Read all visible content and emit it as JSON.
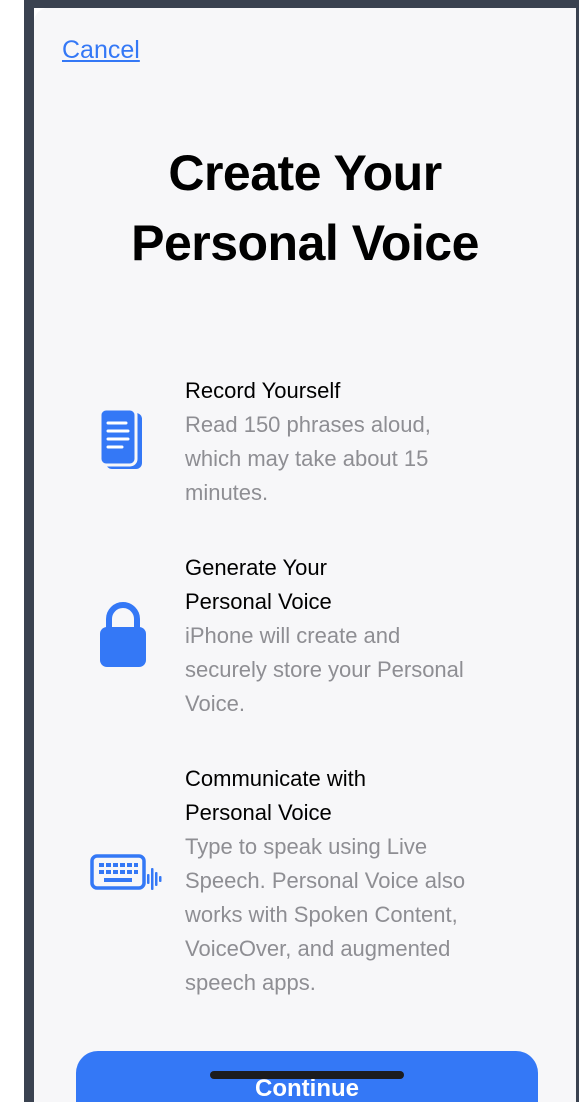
{
  "nav": {
    "cancel_label": "Cancel"
  },
  "title": "Create Your\nPersonal Voice",
  "features": [
    {
      "icon": "document-text-icon",
      "title": "Record Yourself",
      "description": "Read 150 phrases aloud,\nwhich may take about 15\nminutes."
    },
    {
      "icon": "lock-icon",
      "title": "Generate Your\nPersonal Voice",
      "description": "iPhone will create and\nsecurely store your Personal\nVoice."
    },
    {
      "icon": "keyboard-waveform-icon",
      "title": "Communicate with\nPersonal Voice",
      "description": "Type to speak using Live\nSpeech. Personal Voice also\nworks with Spoken Content,\nVoiceOver, and augmented\nspeech apps."
    }
  ],
  "continue_label": "Continue",
  "colors": {
    "accent": "#3478f6",
    "secondary_text": "#8e8e93",
    "background": "#f7f7f9"
  }
}
